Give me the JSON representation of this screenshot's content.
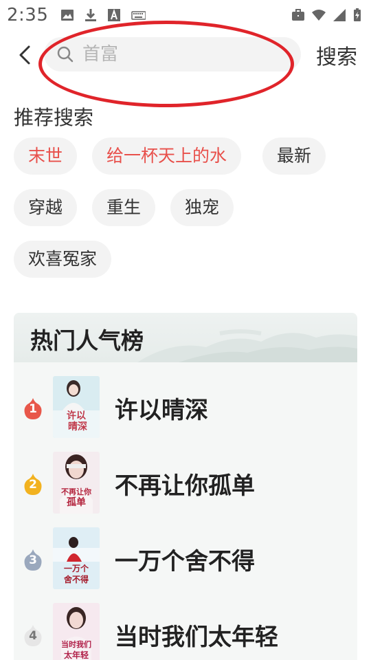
{
  "status_bar": {
    "time": "2:35",
    "left_icons": [
      "image-icon",
      "download-icon",
      "text-icon",
      "keyboard-icon"
    ],
    "right_icons": [
      "briefcase-icon",
      "wifi-icon",
      "signal-icon",
      "battery-charging-icon"
    ]
  },
  "search": {
    "placeholder": "首富",
    "button_label": "搜索",
    "annotation_color": "#e0242a"
  },
  "recommended": {
    "title": "推荐搜索",
    "tags": [
      {
        "label": "末世",
        "hot": true
      },
      {
        "label": "给一杯天上的水",
        "hot": true
      },
      {
        "label": "最新",
        "hot": false
      },
      {
        "label": "穿越",
        "hot": false
      },
      {
        "label": "重生",
        "hot": false
      },
      {
        "label": "独宠",
        "hot": false
      },
      {
        "label": "欢喜冤家",
        "hot": false
      }
    ]
  },
  "hot_list": {
    "title": "热门人气榜",
    "items": [
      {
        "rank": "1",
        "title": "许以晴深",
        "cover_text": "许以晴深",
        "badge_color": "#e8574a"
      },
      {
        "rank": "2",
        "title": "不再让你孤单",
        "cover_text": "不再让你孤单",
        "badge_color": "#f2b21f"
      },
      {
        "rank": "3",
        "title": "一万个舍不得",
        "cover_text": "一万个舍不得",
        "badge_color": "#9aa8bd"
      },
      {
        "rank": "4",
        "title": "当时我们太年轻",
        "cover_text": "当时我们太年轻",
        "badge_color": "#e6e6e6"
      }
    ]
  },
  "colors": {
    "accent_red": "#e8504b",
    "tag_bg": "#f3f3f3",
    "card_bg": "#f5f7f6"
  }
}
